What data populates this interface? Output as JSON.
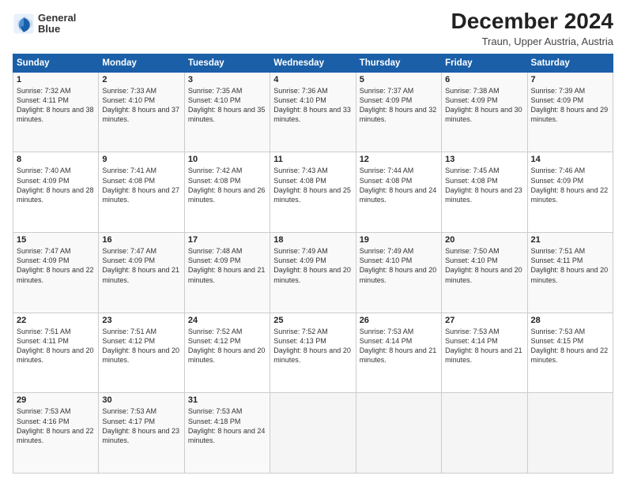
{
  "logo": {
    "line1": "General",
    "line2": "Blue"
  },
  "title": "December 2024",
  "subtitle": "Traun, Upper Austria, Austria",
  "days_of_week": [
    "Sunday",
    "Monday",
    "Tuesday",
    "Wednesday",
    "Thursday",
    "Friday",
    "Saturday"
  ],
  "weeks": [
    [
      {
        "day": "1",
        "sunrise": "Sunrise: 7:32 AM",
        "sunset": "Sunset: 4:11 PM",
        "daylight": "Daylight: 8 hours and 38 minutes."
      },
      {
        "day": "2",
        "sunrise": "Sunrise: 7:33 AM",
        "sunset": "Sunset: 4:10 PM",
        "daylight": "Daylight: 8 hours and 37 minutes."
      },
      {
        "day": "3",
        "sunrise": "Sunrise: 7:35 AM",
        "sunset": "Sunset: 4:10 PM",
        "daylight": "Daylight: 8 hours and 35 minutes."
      },
      {
        "day": "4",
        "sunrise": "Sunrise: 7:36 AM",
        "sunset": "Sunset: 4:10 PM",
        "daylight": "Daylight: 8 hours and 33 minutes."
      },
      {
        "day": "5",
        "sunrise": "Sunrise: 7:37 AM",
        "sunset": "Sunset: 4:09 PM",
        "daylight": "Daylight: 8 hours and 32 minutes."
      },
      {
        "day": "6",
        "sunrise": "Sunrise: 7:38 AM",
        "sunset": "Sunset: 4:09 PM",
        "daylight": "Daylight: 8 hours and 30 minutes."
      },
      {
        "day": "7",
        "sunrise": "Sunrise: 7:39 AM",
        "sunset": "Sunset: 4:09 PM",
        "daylight": "Daylight: 8 hours and 29 minutes."
      }
    ],
    [
      {
        "day": "8",
        "sunrise": "Sunrise: 7:40 AM",
        "sunset": "Sunset: 4:09 PM",
        "daylight": "Daylight: 8 hours and 28 minutes."
      },
      {
        "day": "9",
        "sunrise": "Sunrise: 7:41 AM",
        "sunset": "Sunset: 4:08 PM",
        "daylight": "Daylight: 8 hours and 27 minutes."
      },
      {
        "day": "10",
        "sunrise": "Sunrise: 7:42 AM",
        "sunset": "Sunset: 4:08 PM",
        "daylight": "Daylight: 8 hours and 26 minutes."
      },
      {
        "day": "11",
        "sunrise": "Sunrise: 7:43 AM",
        "sunset": "Sunset: 4:08 PM",
        "daylight": "Daylight: 8 hours and 25 minutes."
      },
      {
        "day": "12",
        "sunrise": "Sunrise: 7:44 AM",
        "sunset": "Sunset: 4:08 PM",
        "daylight": "Daylight: 8 hours and 24 minutes."
      },
      {
        "day": "13",
        "sunrise": "Sunrise: 7:45 AM",
        "sunset": "Sunset: 4:08 PM",
        "daylight": "Daylight: 8 hours and 23 minutes."
      },
      {
        "day": "14",
        "sunrise": "Sunrise: 7:46 AM",
        "sunset": "Sunset: 4:09 PM",
        "daylight": "Daylight: 8 hours and 22 minutes."
      }
    ],
    [
      {
        "day": "15",
        "sunrise": "Sunrise: 7:47 AM",
        "sunset": "Sunset: 4:09 PM",
        "daylight": "Daylight: 8 hours and 22 minutes."
      },
      {
        "day": "16",
        "sunrise": "Sunrise: 7:47 AM",
        "sunset": "Sunset: 4:09 PM",
        "daylight": "Daylight: 8 hours and 21 minutes."
      },
      {
        "day": "17",
        "sunrise": "Sunrise: 7:48 AM",
        "sunset": "Sunset: 4:09 PM",
        "daylight": "Daylight: 8 hours and 21 minutes."
      },
      {
        "day": "18",
        "sunrise": "Sunrise: 7:49 AM",
        "sunset": "Sunset: 4:09 PM",
        "daylight": "Daylight: 8 hours and 20 minutes."
      },
      {
        "day": "19",
        "sunrise": "Sunrise: 7:49 AM",
        "sunset": "Sunset: 4:10 PM",
        "daylight": "Daylight: 8 hours and 20 minutes."
      },
      {
        "day": "20",
        "sunrise": "Sunrise: 7:50 AM",
        "sunset": "Sunset: 4:10 PM",
        "daylight": "Daylight: 8 hours and 20 minutes."
      },
      {
        "day": "21",
        "sunrise": "Sunrise: 7:51 AM",
        "sunset": "Sunset: 4:11 PM",
        "daylight": "Daylight: 8 hours and 20 minutes."
      }
    ],
    [
      {
        "day": "22",
        "sunrise": "Sunrise: 7:51 AM",
        "sunset": "Sunset: 4:11 PM",
        "daylight": "Daylight: 8 hours and 20 minutes."
      },
      {
        "day": "23",
        "sunrise": "Sunrise: 7:51 AM",
        "sunset": "Sunset: 4:12 PM",
        "daylight": "Daylight: 8 hours and 20 minutes."
      },
      {
        "day": "24",
        "sunrise": "Sunrise: 7:52 AM",
        "sunset": "Sunset: 4:12 PM",
        "daylight": "Daylight: 8 hours and 20 minutes."
      },
      {
        "day": "25",
        "sunrise": "Sunrise: 7:52 AM",
        "sunset": "Sunset: 4:13 PM",
        "daylight": "Daylight: 8 hours and 20 minutes."
      },
      {
        "day": "26",
        "sunrise": "Sunrise: 7:53 AM",
        "sunset": "Sunset: 4:14 PM",
        "daylight": "Daylight: 8 hours and 21 minutes."
      },
      {
        "day": "27",
        "sunrise": "Sunrise: 7:53 AM",
        "sunset": "Sunset: 4:14 PM",
        "daylight": "Daylight: 8 hours and 21 minutes."
      },
      {
        "day": "28",
        "sunrise": "Sunrise: 7:53 AM",
        "sunset": "Sunset: 4:15 PM",
        "daylight": "Daylight: 8 hours and 22 minutes."
      }
    ],
    [
      {
        "day": "29",
        "sunrise": "Sunrise: 7:53 AM",
        "sunset": "Sunset: 4:16 PM",
        "daylight": "Daylight: 8 hours and 22 minutes."
      },
      {
        "day": "30",
        "sunrise": "Sunrise: 7:53 AM",
        "sunset": "Sunset: 4:17 PM",
        "daylight": "Daylight: 8 hours and 23 minutes."
      },
      {
        "day": "31",
        "sunrise": "Sunrise: 7:53 AM",
        "sunset": "Sunset: 4:18 PM",
        "daylight": "Daylight: 8 hours and 24 minutes."
      },
      null,
      null,
      null,
      null
    ]
  ]
}
